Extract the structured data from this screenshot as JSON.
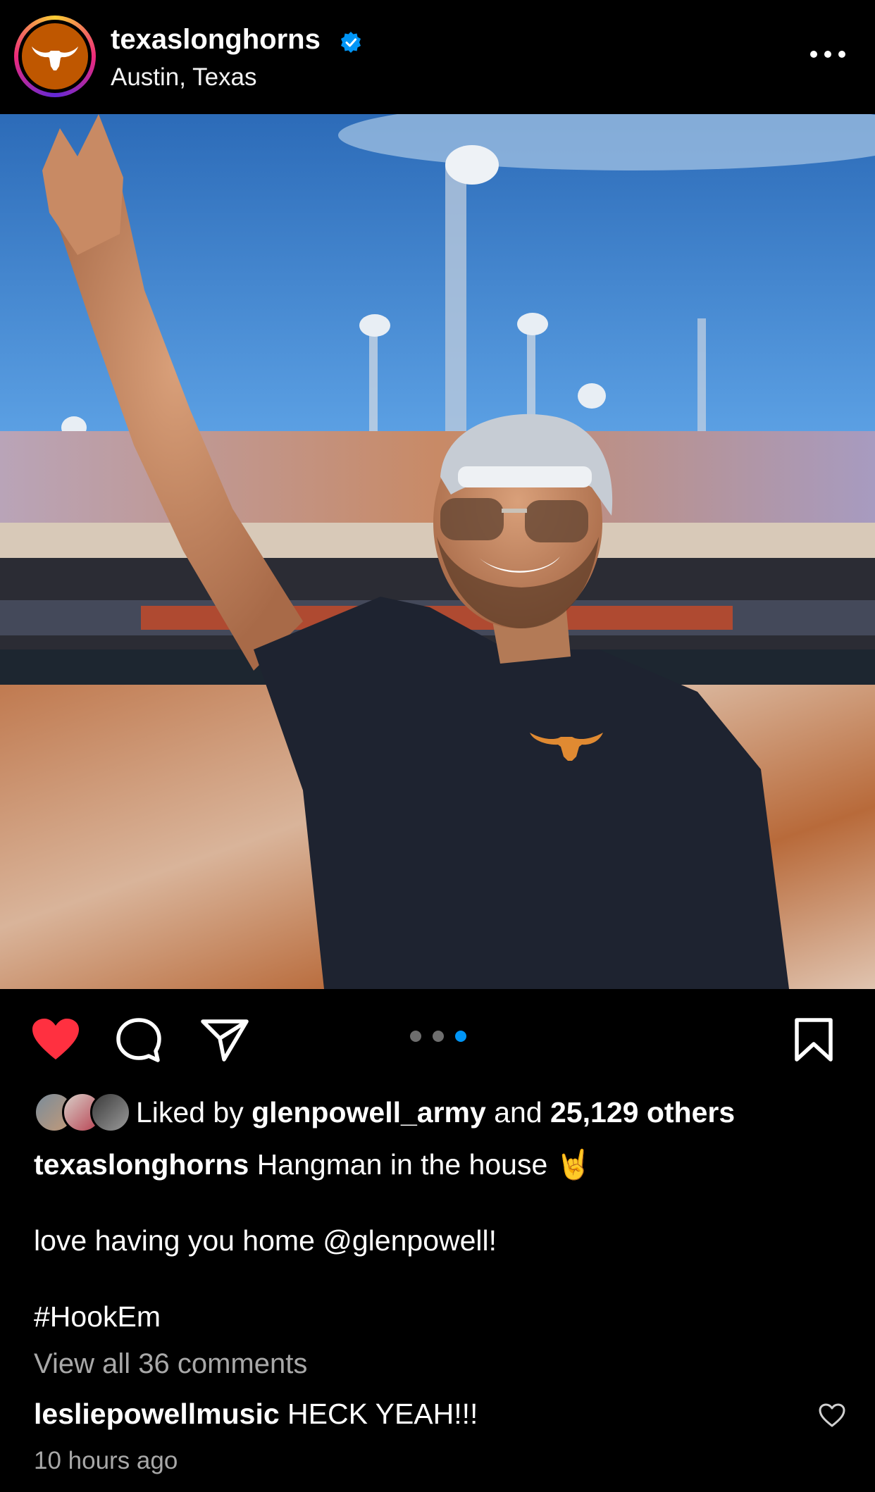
{
  "post": {
    "username": "texaslonghorns",
    "location": "Austin, Texas",
    "verified": true,
    "accent_color": "#bf5700"
  },
  "actions": {
    "like_icon": "heart-filled-icon",
    "liked": true,
    "comment_icon": "comment-icon",
    "share_icon": "paper-plane-icon",
    "save_icon": "bookmark-icon"
  },
  "carousel": {
    "count": 3,
    "active_index": 2,
    "active_color": "#0095f6"
  },
  "likes": {
    "prefix": "Liked by",
    "user": "glenpowell_army",
    "middle": "and",
    "others": "25,129 others"
  },
  "caption": {
    "username": "texaslonghorns",
    "text": "Hangman in the house 🤘",
    "line2": "love having you home @glenpowell!",
    "line3": "#HookEm"
  },
  "comments": {
    "view_all": "View all 36 comments",
    "top_comment_user": "lesliepowellmusic",
    "top_comment_text": "HECK YEAH!!!"
  },
  "timestamp": "10 hours ago"
}
